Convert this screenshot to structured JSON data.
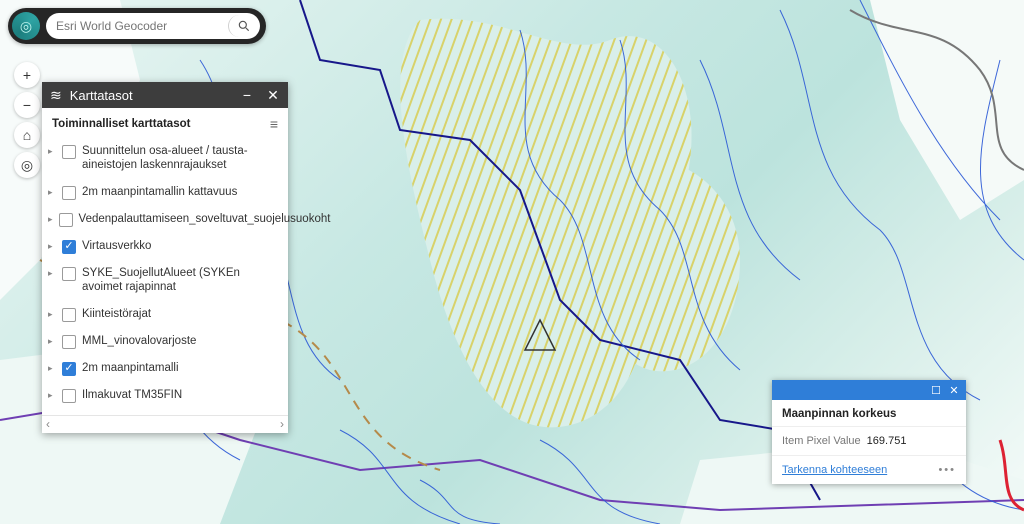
{
  "search": {
    "placeholder": "Esri World Geocoder"
  },
  "toolbar": {
    "zoom_in": "+",
    "zoom_out": "−",
    "home": "⌂",
    "locate": "◎"
  },
  "layers_panel": {
    "title": "Karttatasot",
    "subtitle": "Toiminnalliset karttatasot",
    "items": [
      {
        "label": "Suunnittelun osa-alueet / tausta-aineistojen laskennrajaukset",
        "checked": false
      },
      {
        "label": "2m maanpintamallin kattavuus",
        "checked": false
      },
      {
        "label": "Vedenpalauttamiseen_soveltuvat_suojelusuokoht",
        "checked": false
      },
      {
        "label": "Virtausverkko",
        "checked": true
      },
      {
        "label": "SYKE_SuojellutAlueet (SYKEn avoimet rajapinnat",
        "checked": false
      },
      {
        "label": "Kiinteistörajat",
        "checked": false
      },
      {
        "label": "MML_vinovalovarjoste",
        "checked": false
      },
      {
        "label": "2m maanpintamalli",
        "checked": true
      },
      {
        "label": "Ilmakuvat TM35FIN",
        "checked": false
      }
    ],
    "scroll_left": "‹",
    "scroll_right": "›"
  },
  "popup": {
    "title": "Maanpinnan korkeus",
    "field_label": "Item Pixel Value",
    "field_value": "169.751",
    "zoom_link": "Tarkenna kohteeseen",
    "more": "•••"
  },
  "icons": {
    "layers": "≋",
    "filter": "≡",
    "minimize": "−",
    "close": "✕",
    "maximize": "☐"
  }
}
